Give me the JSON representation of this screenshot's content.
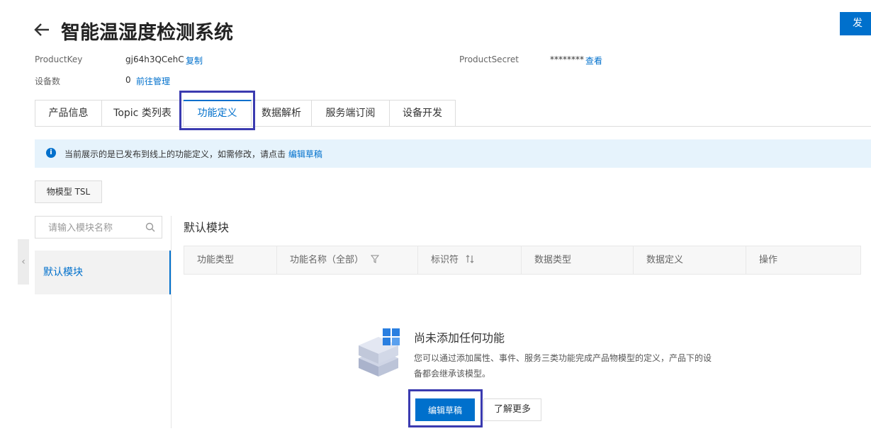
{
  "header": {
    "back_icon": "arrow-left-icon",
    "title": "智能温湿度检测系统",
    "publish_label": "发"
  },
  "info": {
    "product_key_label": "ProductKey",
    "product_key_value": "gj64h3QCehC",
    "copy_label": "复制",
    "product_secret_label": "ProductSecret",
    "product_secret_value": "********",
    "view_label": "查看",
    "device_count_label": "设备数",
    "device_count_value": "0",
    "manage_label": "前往管理"
  },
  "tabs": [
    {
      "label": "产品信息"
    },
    {
      "label": "Topic 类列表"
    },
    {
      "label": "功能定义",
      "active": true
    },
    {
      "label": "数据解析"
    },
    {
      "label": "服务端订阅"
    },
    {
      "label": "设备开发"
    }
  ],
  "notice": {
    "icon": "info-icon",
    "text": "当前展示的是已发布到线上的功能定义，如需修改，请点击",
    "link": "编辑草稿"
  },
  "tsl_button": "物模型 TSL",
  "sidebar": {
    "search_placeholder": "请输入模块名称",
    "modules": [
      {
        "label": "默认模块"
      }
    ]
  },
  "main": {
    "section_title": "默认模块",
    "columns": [
      "功能类型",
      "功能名称（全部）",
      "标识符",
      "数据类型",
      "数据定义",
      "操作"
    ]
  },
  "empty_state": {
    "title": "尚未添加任何功能",
    "description": "您可以通过添加属性、事件、服务三类功能完成产品物模型的定义，产品下的设备都会继承该模型。",
    "edit_label": "编辑草稿",
    "learn_label": "了解更多"
  },
  "colors": {
    "primary": "#0070cc",
    "notice_bg": "#e6f3fc",
    "highlight": "#3b3bb0"
  }
}
